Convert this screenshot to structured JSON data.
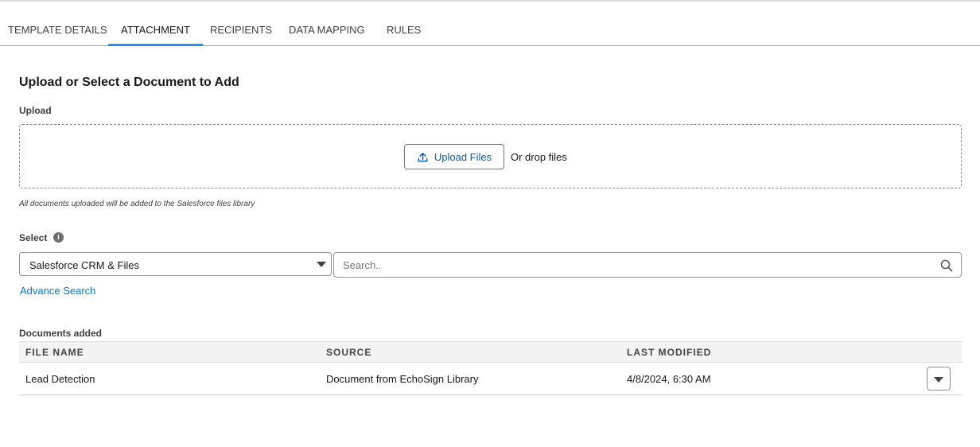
{
  "tabs": [
    {
      "label": "TEMPLATE DETAILS",
      "active": false
    },
    {
      "label": "ATTACHMENT",
      "active": true
    },
    {
      "label": "RECIPIENTS",
      "active": false
    },
    {
      "label": "DATA MAPPING",
      "active": false
    },
    {
      "label": "RULES",
      "active": false
    }
  ],
  "section": {
    "title": "Upload or Select a Document to Add"
  },
  "upload": {
    "label": "Upload",
    "button_label": "Upload Files",
    "drop_text": "Or drop files",
    "note": "All documents uploaded will be added to the Salesforce files library"
  },
  "select": {
    "label": "Select",
    "source_value": "Salesforce CRM & Files",
    "search_placeholder": "Search..",
    "advance_search": "Advance Search"
  },
  "documents": {
    "label": "Documents added",
    "columns": [
      "FILE NAME",
      "SOURCE",
      "LAST MODIFIED"
    ],
    "rows": [
      [
        "Lead Detection",
        "Document from EchoSign Library",
        "4/8/2024, 6:30 AM"
      ]
    ]
  },
  "colors": {
    "accent": "#1b96ff",
    "link": "#0176d3"
  },
  "icons": [
    "upload-icon",
    "info-icon",
    "chevron-down-icon",
    "search-icon"
  ]
}
